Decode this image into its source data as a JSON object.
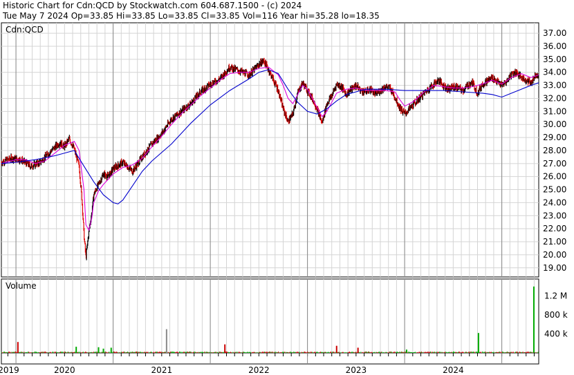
{
  "header": {
    "line1": "Historic Chart for Cdn:QCD by Stockwatch.com 604.687.1500 - (c) 2024",
    "line2": "Tue May  7 2024   Op=33.85  Hi=33.85  Lo=33.85  Cl=33.85  Vol=116   Year hi=35.28  lo=18.35"
  },
  "chart_data": [
    {
      "type": "line",
      "title": "Cdn:QCD",
      "ylim": [
        18.3,
        37.8
      ],
      "y_ticks": [
        "37.00",
        "36.00",
        "35.00",
        "34.00",
        "33.00",
        "32.00",
        "31.00",
        "30.00",
        "29.00",
        "28.00",
        "27.00",
        "26.00",
        "25.00",
        "24.00",
        "23.00",
        "22.00",
        "21.00",
        "20.00",
        "19.00"
      ],
      "x_labels": [
        "2019",
        "2020",
        "2021",
        "2022",
        "2023",
        "2024"
      ],
      "x_range": [
        2018.85,
        2024.38
      ],
      "x_dividers": [
        2019.0,
        2020.0,
        2021.0,
        2022.0,
        2023.0,
        2024.0
      ],
      "month_gridlines": true,
      "price_colors": {
        "up": "#000000",
        "down": "#dd0000"
      },
      "series": [
        {
          "name": "",
          "style": "price",
          "color": "#000000",
          "x": [
            2018.85,
            2018.95,
            2019.05,
            2019.15,
            2019.25,
            2019.35,
            2019.45,
            2019.5,
            2019.55,
            2019.6,
            2019.65,
            2019.68,
            2019.7,
            2019.72,
            2019.75,
            2019.78,
            2019.8,
            2019.85,
            2019.9,
            2019.95,
            2020.0,
            2020.1,
            2020.2,
            2020.3,
            2020.4,
            2020.5,
            2020.6,
            2020.7,
            2020.8,
            2020.9,
            2021.0,
            2021.1,
            2021.2,
            2021.3,
            2021.4,
            2021.5,
            2021.55,
            2021.6,
            2021.65,
            2021.7,
            2021.75,
            2021.8,
            2021.85,
            2021.9,
            2021.95,
            2022.0,
            2022.05,
            2022.1,
            2022.15,
            2022.2,
            2022.25,
            2022.3,
            2022.35,
            2022.4,
            2022.45,
            2022.5,
            2022.55,
            2022.6,
            2022.65,
            2022.7,
            2022.75,
            2022.8,
            2022.85,
            2022.9,
            2022.95,
            2023.0,
            2023.1,
            2023.2,
            2023.3,
            2023.35,
            2023.4,
            2023.45,
            2023.5,
            2023.55,
            2023.6,
            2023.65,
            2023.7,
            2023.75,
            2023.8,
            2023.9,
            2024.0,
            2024.05,
            2024.1,
            2024.15,
            2024.2,
            2024.25,
            2024.3,
            2024.35
          ],
          "values": [
            27.1,
            27.4,
            27.3,
            26.8,
            27.1,
            27.9,
            28.6,
            28.3,
            28.9,
            28.1,
            26.8,
            24.2,
            21.5,
            19.8,
            21.8,
            23.2,
            24.6,
            25.4,
            26.2,
            26.0,
            26.6,
            27.1,
            26.4,
            27.5,
            28.5,
            29.3,
            30.4,
            31.0,
            31.6,
            32.5,
            33.1,
            33.5,
            34.4,
            34.1,
            33.8,
            34.6,
            34.9,
            34.2,
            33.4,
            32.6,
            31.2,
            30.2,
            30.8,
            32.4,
            33.2,
            32.6,
            32.0,
            31.2,
            30.1,
            31.6,
            32.2,
            33.1,
            32.9,
            32.3,
            32.7,
            33.0,
            32.6,
            32.5,
            32.7,
            32.3,
            32.6,
            32.9,
            32.8,
            32.1,
            31.3,
            30.8,
            31.6,
            32.4,
            33.1,
            33.4,
            33.0,
            32.7,
            32.9,
            32.8,
            32.6,
            33.0,
            33.2,
            32.4,
            33.1,
            33.6,
            33.0,
            33.3,
            33.9,
            34.0,
            33.6,
            33.4,
            33.2,
            33.85
          ]
        },
        {
          "name": "",
          "style": "short moving average",
          "color": "#dd00dd",
          "x": [
            2018.85,
            2019.0,
            2019.1,
            2019.2,
            2019.3,
            2019.4,
            2019.5,
            2019.6,
            2019.65,
            2019.7,
            2019.72,
            2019.75,
            2019.78,
            2019.8,
            2019.85,
            2019.9,
            2019.95,
            2020.0,
            2020.1,
            2020.2,
            2020.3,
            2020.4,
            2020.5,
            2020.6,
            2020.7,
            2020.8,
            2020.9,
            2021.0,
            2021.1,
            2021.2,
            2021.3,
            2021.4,
            2021.5,
            2021.6,
            2021.7,
            2021.75,
            2021.8,
            2021.85,
            2021.9,
            2021.95,
            2022.0,
            2022.05,
            2022.1,
            2022.15,
            2022.2,
            2022.25,
            2022.3,
            2022.4,
            2022.5,
            2022.6,
            2022.7,
            2022.8,
            2022.9,
            2022.95,
            2023.0,
            2023.1,
            2023.2,
            2023.3,
            2023.4,
            2023.5,
            2023.6,
            2023.7,
            2023.8,
            2023.9,
            2024.0,
            2024.1,
            2024.2,
            2024.3,
            2024.38
          ],
          "values": [
            27.0,
            27.3,
            27.3,
            27.0,
            27.2,
            27.8,
            28.4,
            28.7,
            28.0,
            25.0,
            22.3,
            21.9,
            22.8,
            24.0,
            24.9,
            25.4,
            25.8,
            26.2,
            26.7,
            26.9,
            27.4,
            28.3,
            29.1,
            30.0,
            30.8,
            31.5,
            32.2,
            32.8,
            33.4,
            33.9,
            34.0,
            34.0,
            34.3,
            34.4,
            33.8,
            33.0,
            32.0,
            31.6,
            32.3,
            33.0,
            32.7,
            32.0,
            31.3,
            30.6,
            31.0,
            31.7,
            32.4,
            32.7,
            32.8,
            32.6,
            32.6,
            32.6,
            32.5,
            31.9,
            31.4,
            31.8,
            32.5,
            33.0,
            32.9,
            32.8,
            32.8,
            32.9,
            33.1,
            33.4,
            33.1,
            33.6,
            33.9,
            33.6,
            33.8
          ]
        },
        {
          "name": "",
          "style": "long moving average",
          "color": "#0000cc",
          "x": [
            2018.85,
            2019.0,
            2019.2,
            2019.4,
            2019.6,
            2019.7,
            2019.8,
            2019.9,
            2020.0,
            2020.05,
            2020.1,
            2020.2,
            2020.3,
            2020.4,
            2020.6,
            2020.8,
            2021.0,
            2021.2,
            2021.4,
            2021.5,
            2021.6,
            2021.7,
            2021.75,
            2021.8,
            2021.9,
            2022.0,
            2022.1,
            2022.2,
            2022.3,
            2022.4,
            2022.6,
            2022.8,
            2023.0,
            2023.2,
            2023.4,
            2023.6,
            2023.8,
            2023.9,
            2024.0,
            2024.1,
            2024.2,
            2024.3,
            2024.38
          ],
          "values": [
            27.0,
            27.1,
            27.3,
            27.6,
            28.0,
            26.8,
            25.6,
            24.6,
            24.0,
            23.9,
            24.2,
            25.3,
            26.4,
            27.2,
            28.5,
            30.1,
            31.5,
            32.6,
            33.5,
            34.0,
            34.2,
            33.9,
            33.3,
            32.7,
            31.7,
            31.0,
            30.8,
            31.2,
            31.8,
            32.3,
            32.7,
            32.7,
            32.6,
            32.6,
            32.6,
            32.5,
            32.4,
            32.3,
            32.1,
            32.4,
            32.7,
            33.0,
            33.2
          ]
        }
      ]
    },
    {
      "type": "bar",
      "title": "Volume",
      "ylim": [
        0,
        1500000
      ],
      "y_ticks": [
        "1.2 M",
        "800 k",
        "400 k"
      ],
      "y_tick_values": [
        1200000,
        800000,
        400000
      ],
      "x_range": [
        2018.85,
        2024.38
      ],
      "x_labels": [
        "2019",
        "2020",
        "2021",
        "2022",
        "2023",
        "2024"
      ],
      "bar_colors": {
        "up": "#00aa00",
        "down": "#cc0000",
        "flat": "#888888"
      },
      "spikes": [
        {
          "x": 2019.02,
          "value": 230000,
          "dir": "down"
        },
        {
          "x": 2019.62,
          "value": 130000,
          "dir": "up"
        },
        {
          "x": 2019.85,
          "value": 120000,
          "dir": "up"
        },
        {
          "x": 2019.9,
          "value": 90000,
          "dir": "up"
        },
        {
          "x": 2019.98,
          "value": 110000,
          "dir": "up"
        },
        {
          "x": 2020.55,
          "value": 500000,
          "dir": "flat"
        },
        {
          "x": 2021.15,
          "value": 180000,
          "dir": "down"
        },
        {
          "x": 2022.3,
          "value": 150000,
          "dir": "down"
        },
        {
          "x": 2022.52,
          "value": 110000,
          "dir": "down"
        },
        {
          "x": 2023.02,
          "value": 70000,
          "dir": "up"
        },
        {
          "x": 2023.76,
          "value": 420000,
          "dir": "up"
        },
        {
          "x": 2024.33,
          "value": 1400000,
          "dir": "up"
        }
      ]
    }
  ]
}
